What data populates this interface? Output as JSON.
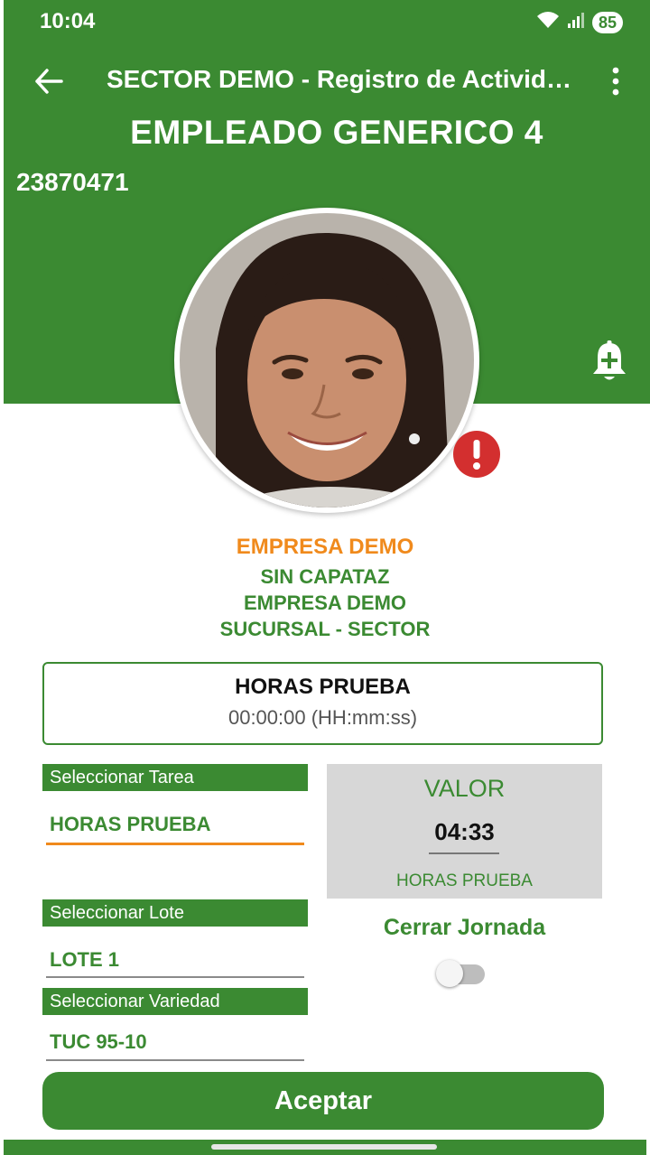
{
  "status_bar": {
    "time": "10:04",
    "battery": "85"
  },
  "appbar": {
    "title": "SECTOR DEMO - Registro de Actividades"
  },
  "employee": {
    "name": "EMPLEADO GENERICO 4",
    "id": "23870471"
  },
  "details": {
    "company": "EMPRESA DEMO",
    "foreman": "SIN CAPATAZ",
    "company2": "EMPRESA DEMO",
    "location": "SUCURSAL  -  SECTOR"
  },
  "hours_card": {
    "title": "HORAS PRUEBA",
    "time": "00:00:00 (HH:mm:ss)"
  },
  "form": {
    "task_label": "Seleccionar Tarea",
    "task_value": "HORAS PRUEBA",
    "lot_label": "Seleccionar Lote",
    "lot_value": "LOTE 1",
    "variety_label": "Seleccionar Variedad",
    "variety_value": "TUC 95-10"
  },
  "valor": {
    "title": "VALOR",
    "value": "04:33",
    "subtitle": "HORAS PRUEBA"
  },
  "close_shift": {
    "label": "Cerrar Jornada",
    "enabled": false
  },
  "accept_button": {
    "label": "Aceptar"
  },
  "colors": {
    "primary": "#3b8a32",
    "accent": "#f08a1c",
    "alert": "#d32f2f"
  },
  "icons": [
    "back-arrow-icon",
    "more-vert-icon",
    "bell-plus-icon",
    "alert-icon",
    "wifi-icon",
    "signal-icon"
  ]
}
